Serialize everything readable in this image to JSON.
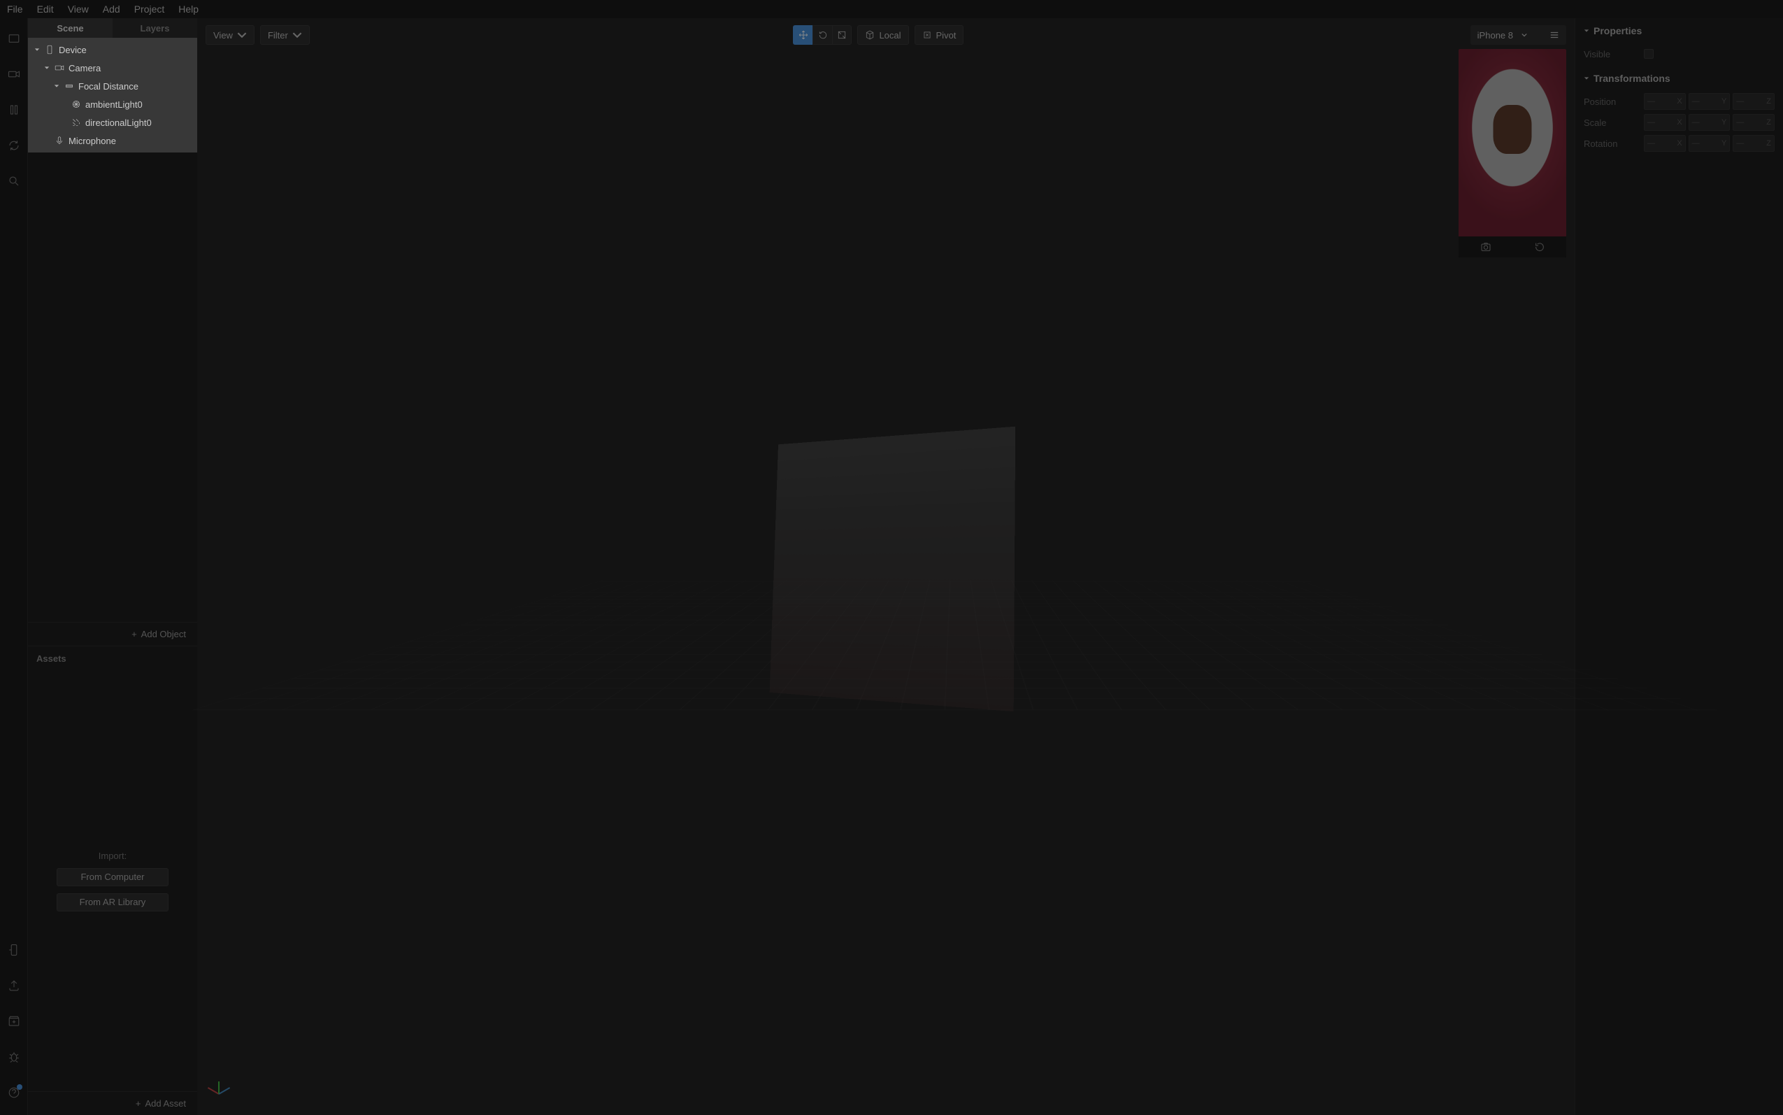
{
  "menubar": [
    "File",
    "Edit",
    "View",
    "Add",
    "Project",
    "Help"
  ],
  "left_tabs": {
    "scene": "Scene",
    "layers": "Layers"
  },
  "tree": {
    "device": "Device",
    "camera": "Camera",
    "focal": "Focal Distance",
    "ambient": "ambientLight0",
    "directional": "directionalLight0",
    "microphone": "Microphone"
  },
  "add_object": "Add Object",
  "assets": {
    "title": "Assets",
    "import": "Import:",
    "from_computer": "From Computer",
    "from_library": "From AR Library",
    "add_asset": "Add Asset"
  },
  "viewport": {
    "view": "View",
    "filter": "Filter",
    "local": "Local",
    "pivot": "Pivot"
  },
  "device_selector": "iPhone 8",
  "properties": {
    "title": "Properties",
    "visible": "Visible",
    "transformations": "Transformations",
    "position": "Position",
    "scale": "Scale",
    "rotation": "Rotation",
    "axes": {
      "x": "X",
      "y": "Y",
      "z": "Z"
    },
    "dash": "—"
  }
}
